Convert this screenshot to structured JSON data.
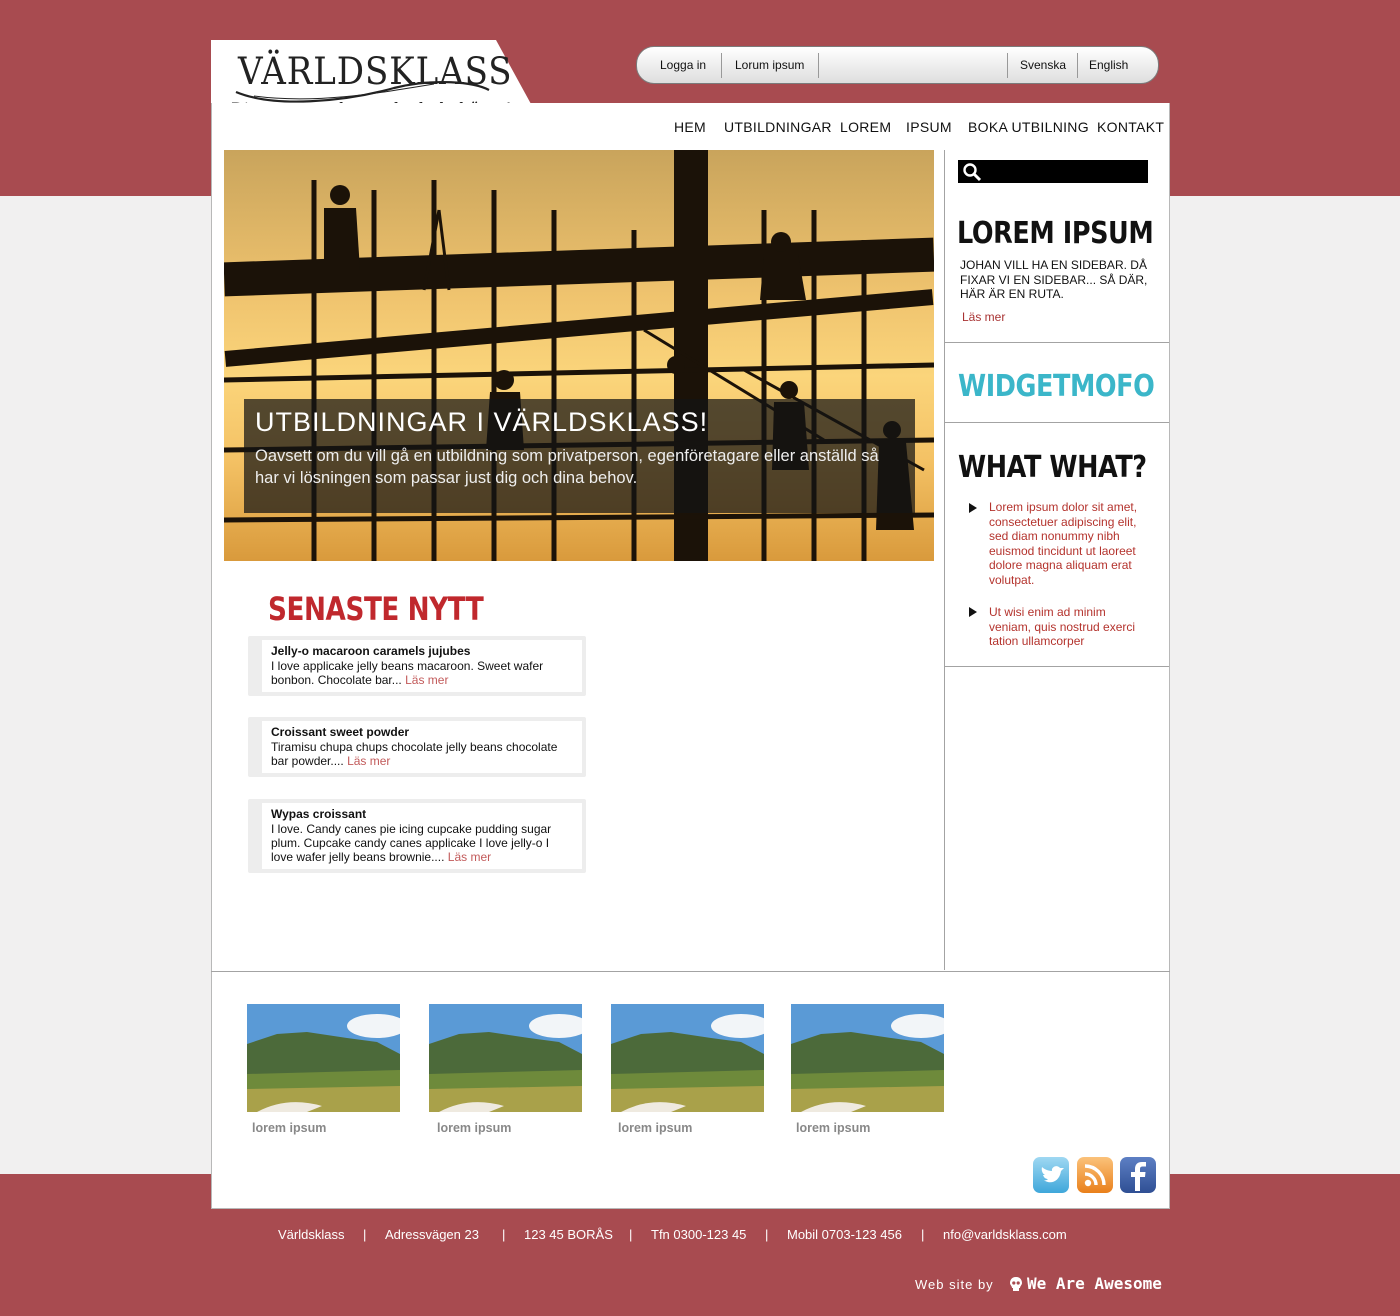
{
  "brand": {
    "name": "VÄRLDSKLASS",
    "tagline": "Din partner, den enda du behöver!"
  },
  "topbar": {
    "login": "Logga in",
    "lorum": "Lorum ipsum",
    "lang_sv": "Svenska",
    "lang_en": "English"
  },
  "nav": {
    "items": [
      "HEM",
      "UTBILDNINGAR",
      "LOREM",
      "IPSUM",
      "BOKA UTBILNING",
      "KONTAKT"
    ]
  },
  "hero": {
    "title": "UTBILDNINGAR I VÄRLDSKLASS!",
    "text": "Oavsett om du vill gå en utbildning som privatperson, egenföretagare eller anställd så har vi lösningen som passar just dig och dina behov."
  },
  "sidebar": {
    "box1": {
      "heading": "LOREM IPSUM",
      "text": "JOHAN VILL HA EN SIDEBAR. DÅ FIXAR VI EN SIDEBAR... SÅ DÄR, HÄR ÄR EN RUTA.",
      "link": "Läs mer"
    },
    "box2": {
      "heading": "WIDGETMOFO"
    },
    "box3": {
      "heading": "WHAT WHAT?",
      "items": [
        "Lorem ipsum dolor sit amet, consectetuer adipiscing elit, sed diam nonummy nibh euismod tincidunt ut laoreet dolore magna aliquam erat volutpat.",
        "Ut wisi enim ad minim veniam, quis nostrud exerci tation ullamcorper"
      ]
    }
  },
  "news": {
    "heading": "SENASTE NYTT",
    "read_more": "Läs mer",
    "items": [
      {
        "title": "Jelly-o macaroon caramels jujubes",
        "text": "I love applicake jelly beans macaroon. Sweet wafer bonbon. Chocolate bar..."
      },
      {
        "title": "Croissant sweet powder",
        "text": "Tiramisu chupa chups chocolate jelly beans chocolate bar powder...."
      },
      {
        "title": "Wypas croissant",
        "text": "I love. Candy canes pie icing cupcake pudding sugar plum. Cupcake candy canes applicake I love jelly-o I love wafer jelly beans brownie...."
      }
    ]
  },
  "gallery": {
    "captions": [
      "lorem ipsum",
      "lorem ipsum",
      "lorem ipsum",
      "lorem ipsum"
    ]
  },
  "social": [
    "twitter-icon",
    "rss-icon",
    "facebook-icon"
  ],
  "footer": {
    "company": "Världsklass",
    "address": "Adressvägen  23",
    "city": "123 45 BORÅS",
    "phone": "Tfn 0300-123 45",
    "mobile": "Mobil 0703-123 456",
    "email": "nfo@varldsklass.com",
    "separator": "|",
    "credit_prefix": "Web site by",
    "credit_name": "We Are Awesome"
  },
  "colors": {
    "brand_red": "#a84b50",
    "heading_red": "#c0282d",
    "widget_cyan": "#3bb6c9",
    "link_red": "#b4332d"
  }
}
